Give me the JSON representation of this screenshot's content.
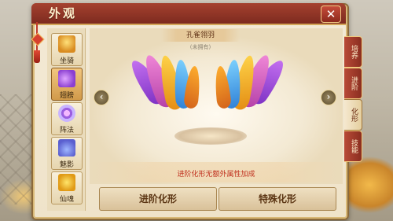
{
  "window": {
    "title": "外观",
    "close_label": "✕"
  },
  "left_nav": {
    "items": [
      {
        "label": "坐骑",
        "icon": "mount-icon"
      },
      {
        "label": "翅膀",
        "icon": "wings-icon",
        "active": true
      },
      {
        "label": "阵法",
        "icon": "array-icon"
      },
      {
        "label": "魅影",
        "icon": "shadow-icon"
      },
      {
        "label": "仙魂",
        "icon": "spirit-icon"
      }
    ]
  },
  "stage": {
    "item_name": "孔雀翎羽",
    "owned_status": "(未拥有)",
    "prev_arrow": "‹",
    "next_arrow": "›",
    "hint": "进阶化形无额外属性加成"
  },
  "actions": {
    "advance_label": "进阶化形",
    "special_label": "特殊化形"
  },
  "right_tabs": [
    {
      "label": "培养"
    },
    {
      "label": "进阶"
    },
    {
      "label": "化形",
      "active": true
    },
    {
      "label": "技能"
    }
  ],
  "colors": {
    "title_bar": "#8f3324",
    "panel": "#f1e6cd",
    "hint_red": "#c0301e",
    "wing_purple": "#b35ce8",
    "wing_gold": "#f4b52a",
    "wing_pink": "#f06bc8"
  }
}
